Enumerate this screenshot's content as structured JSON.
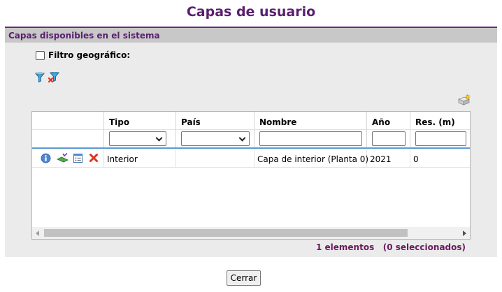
{
  "page_title": "Capas de usuario",
  "panel": {
    "header": "Capas disponibles en el sistema",
    "geo_filter_label": "Filtro geográfico:",
    "geo_filter_checked": false
  },
  "icons": {
    "filter": "filter-icon",
    "clear_filter": "clear-filter-icon",
    "add_layer": "add-layer-icon",
    "info": "info-icon",
    "map_layer": "map-layer-icon",
    "properties": "properties-icon",
    "delete": "delete-icon"
  },
  "colors": {
    "title": "#5a1f6e",
    "header_bar": "#c8c8c8",
    "accent_line": "#5b9bd5",
    "count_text": "#6b1a5e"
  },
  "table": {
    "columns": [
      {
        "label": "",
        "filter": "none"
      },
      {
        "label": "Tipo",
        "filter": "select",
        "value": ""
      },
      {
        "label": "País",
        "filter": "select",
        "value": ""
      },
      {
        "label": "Nombre",
        "filter": "text",
        "value": ""
      },
      {
        "label": "Año",
        "filter": "text",
        "value": ""
      },
      {
        "label": "Res. (m)",
        "filter": "text",
        "value": ""
      }
    ],
    "rows": [
      {
        "tipo": "Interior",
        "pais": "",
        "nombre": "Capa de interior (Planta 0)",
        "anio": "2021",
        "res": "0"
      }
    ]
  },
  "footer": {
    "elements_count": "1 elementos",
    "selected_count": "(0 seleccionados)"
  },
  "close_button": "Cerrar"
}
